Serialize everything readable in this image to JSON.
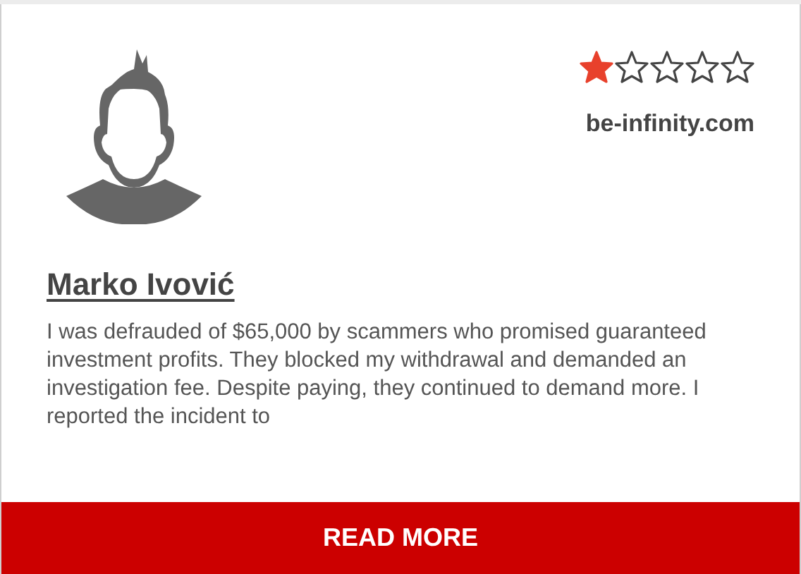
{
  "review": {
    "stars": 1,
    "site": "be-infinity.com",
    "author": "Marko Ivović",
    "text": "I was defrauded of $65,000 by scammers who promised guaranteed investment profits. They blocked my withdrawal and demanded an investigation fee. Despite paying, they continued to demand more. I reported the incident to"
  },
  "button": {
    "label": "READ MORE"
  }
}
